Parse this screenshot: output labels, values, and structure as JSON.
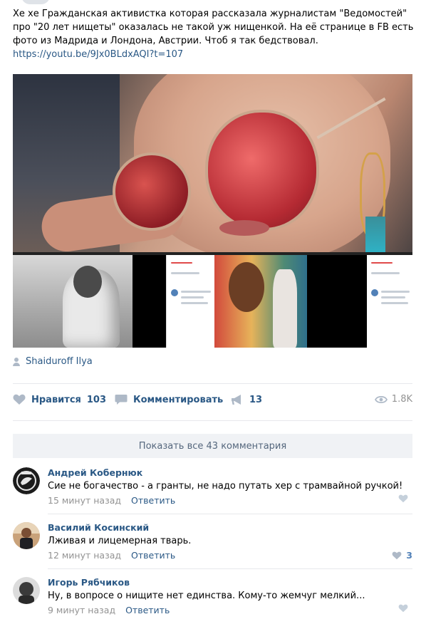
{
  "post": {
    "text": "Хе хе Гражданская активистка которая рассказала журналистам \"Ведомостей\" про \"20 лет нищеты\" оказалась не такой уж нищенкой. На её странице в FB есть фото из Мадрида и Лондона, Австрии. Чтоб я так бедствовал.",
    "link": "https://youtu.be/9Jx0BLdxAQI?t=107",
    "author": "Shaiduroff Ilya"
  },
  "actions": {
    "like_label": "Нравится",
    "like_count": "103",
    "comment_label": "Комментировать",
    "share_count": "13",
    "views": "1.8K"
  },
  "comments_block": {
    "show_all": "Показать все 43 комментария",
    "reply_label": "Ответить",
    "items": [
      {
        "name": "Андрей Кобернюк",
        "text": "Сие не богачество - а гранты, не надо путать хер с трамвайной ручкой!",
        "time": "15 минут назад",
        "likes": ""
      },
      {
        "name": "Василий Косинский",
        "text": "Лживая и лицемерная тварь.",
        "time": "12 минут назад",
        "likes": "3"
      },
      {
        "name": "Игорь Рябчиков",
        "text": "Ну, в вопросе о нищите нет единства. Кому-то жемчуг мелкий...",
        "time": "9 минут назад",
        "likes": ""
      }
    ]
  },
  "colors": {
    "link": "#2a5885",
    "muted": "#939393",
    "icon": "#aeb9c7",
    "button_bg": "#f0f2f5"
  },
  "icons": {
    "like": "heart-icon",
    "comment": "speech-bubble-icon",
    "share": "megaphone-icon",
    "views": "eye-icon",
    "author": "person-icon"
  }
}
